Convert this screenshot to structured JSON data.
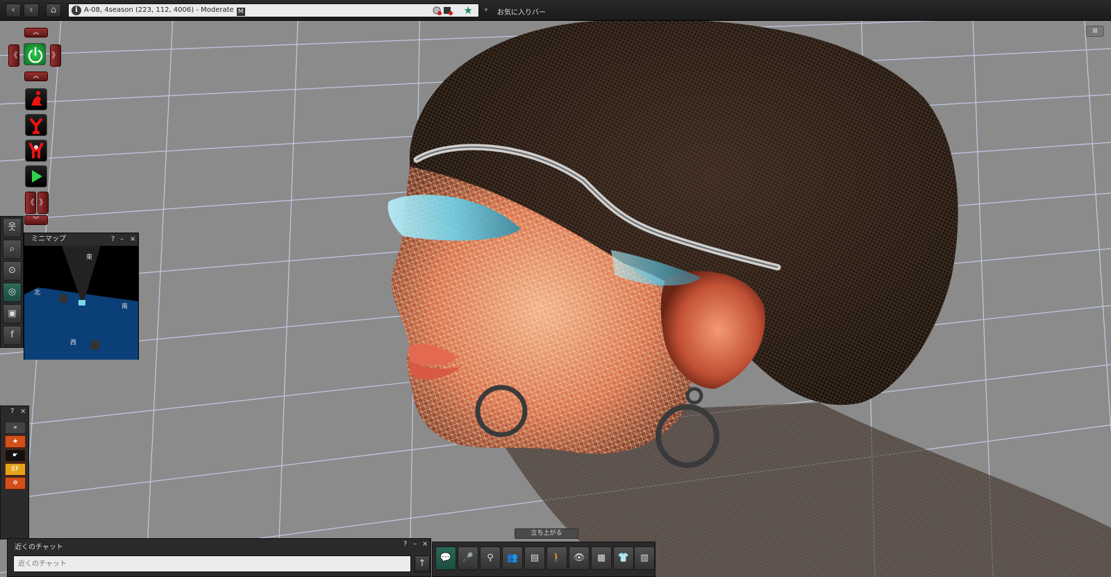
{
  "navbar": {
    "back": "‹",
    "forward": "›",
    "home": "⌂",
    "location": "A-08, 4season (223, 112, 4006) - Moderate",
    "rating_badge": "M",
    "info_icon": "i",
    "favorite_star": "★",
    "dropdown": "▾",
    "favorites_bar": "お気に入りバー"
  },
  "hud": {
    "up": "︽",
    "down": "︾",
    "left": "《",
    "right": "》",
    "play": "▶"
  },
  "left_toolbar": {
    "people": "웃",
    "search": "⌕",
    "places": "⊙",
    "radar": "◎",
    "snapshot": "▣",
    "facebook": "f"
  },
  "minimap": {
    "title": "ミニマップ",
    "help": "?",
    "minimize": "–",
    "close": "×",
    "north": "北",
    "east": "東",
    "south": "南",
    "west": "西"
  },
  "hud_panel": {
    "help": "?",
    "close": "×",
    "expand": "»",
    "items": [
      "★",
      "☛",
      "EF",
      "✲"
    ]
  },
  "chat": {
    "title": "近くのチャット",
    "help": "?",
    "minimize": "–",
    "close": "×",
    "placeholder": "近くのチャット",
    "send": "↑"
  },
  "stand_button": "立ち上がる",
  "bottom_toolbar": [
    "💬",
    "🎤",
    "⚲",
    "👥",
    "▤",
    "🚶",
    "👁",
    "▦",
    "👕",
    "▥"
  ],
  "corner_button": "⊠",
  "colors": {
    "grid_line": "#c9d2f0",
    "background": "#8b8b8b",
    "hud_red": "#9a3030",
    "hud_green": "#27b34a",
    "minimap_water": "#0b3f78",
    "accent_teal": "#2a6a5a"
  }
}
